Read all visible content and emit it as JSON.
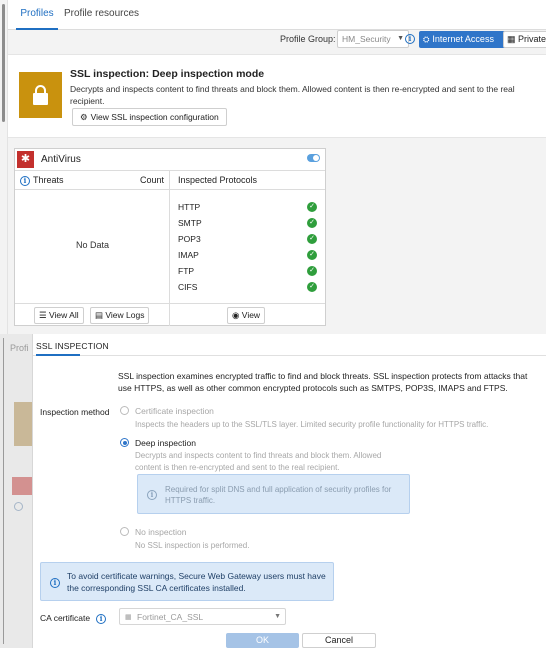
{
  "tabs": [
    "Profiles",
    "Profile resources"
  ],
  "toolbar": {
    "profile_group_label": "Profile Group:",
    "profile_group_value": "HM_Security",
    "internet_access_label": "Internet Access",
    "private_label": "Private"
  },
  "ssl_banner": {
    "title": "SSL inspection: Deep inspection mode",
    "description": "Decrypts and inspects content to find threats and block them. Allowed content is then re-encrypted and sent to the real recipient.",
    "view_button": "View SSL inspection configuration"
  },
  "antivirus": {
    "title": "AntiVirus",
    "enabled": true,
    "threats_header": "Threats",
    "count_header": "Count",
    "no_data": "No Data",
    "protocols_header": "Inspected Protocols",
    "protocols": [
      "HTTP",
      "SMTP",
      "POP3",
      "IMAP",
      "FTP",
      "CIFS"
    ],
    "view_all": "View All",
    "view_logs": "View Logs",
    "view": "View"
  },
  "background": {
    "tab_fragment": "Profi"
  },
  "dialog": {
    "title": "SSL INSPECTION",
    "intro": "SSL inspection examines encrypted traffic to find and block threats. SSL inspection protects from attacks that use HTTPS, as well as other common encrypted protocols such as SMTPS, POP3S, IMAPS and FTPS.",
    "inspection_method_label": "Inspection method",
    "options": [
      {
        "title": "Certificate inspection",
        "description": "Inspects the headers up to the SSL/TLS layer. Limited security profile functionality for HTTPS traffic.",
        "selected": false
      },
      {
        "title": "Deep inspection",
        "description": "Decrypts and inspects content to find threats and block them. Allowed content is then re-encrypted and sent to the real recipient.",
        "selected": true
      },
      {
        "title": "No inspection",
        "description": "No SSL inspection is performed.",
        "selected": false
      }
    ],
    "deep_hint": "Required for split DNS and full application of security profiles for HTTPS traffic.",
    "warning": "To avoid certificate warnings, Secure Web Gateway users must have the corresponding SSL CA certificates installed.",
    "ca_label": "CA certificate",
    "ca_value": "Fortinet_CA_SSL",
    "ok": "OK",
    "cancel": "Cancel"
  },
  "colors": {
    "accent": "#2f75c9",
    "ssl_badge": "#c9920e",
    "antivirus_badge": "#c3302d",
    "check_green": "#2f9e3c",
    "info_box": "#dbe9f8"
  }
}
